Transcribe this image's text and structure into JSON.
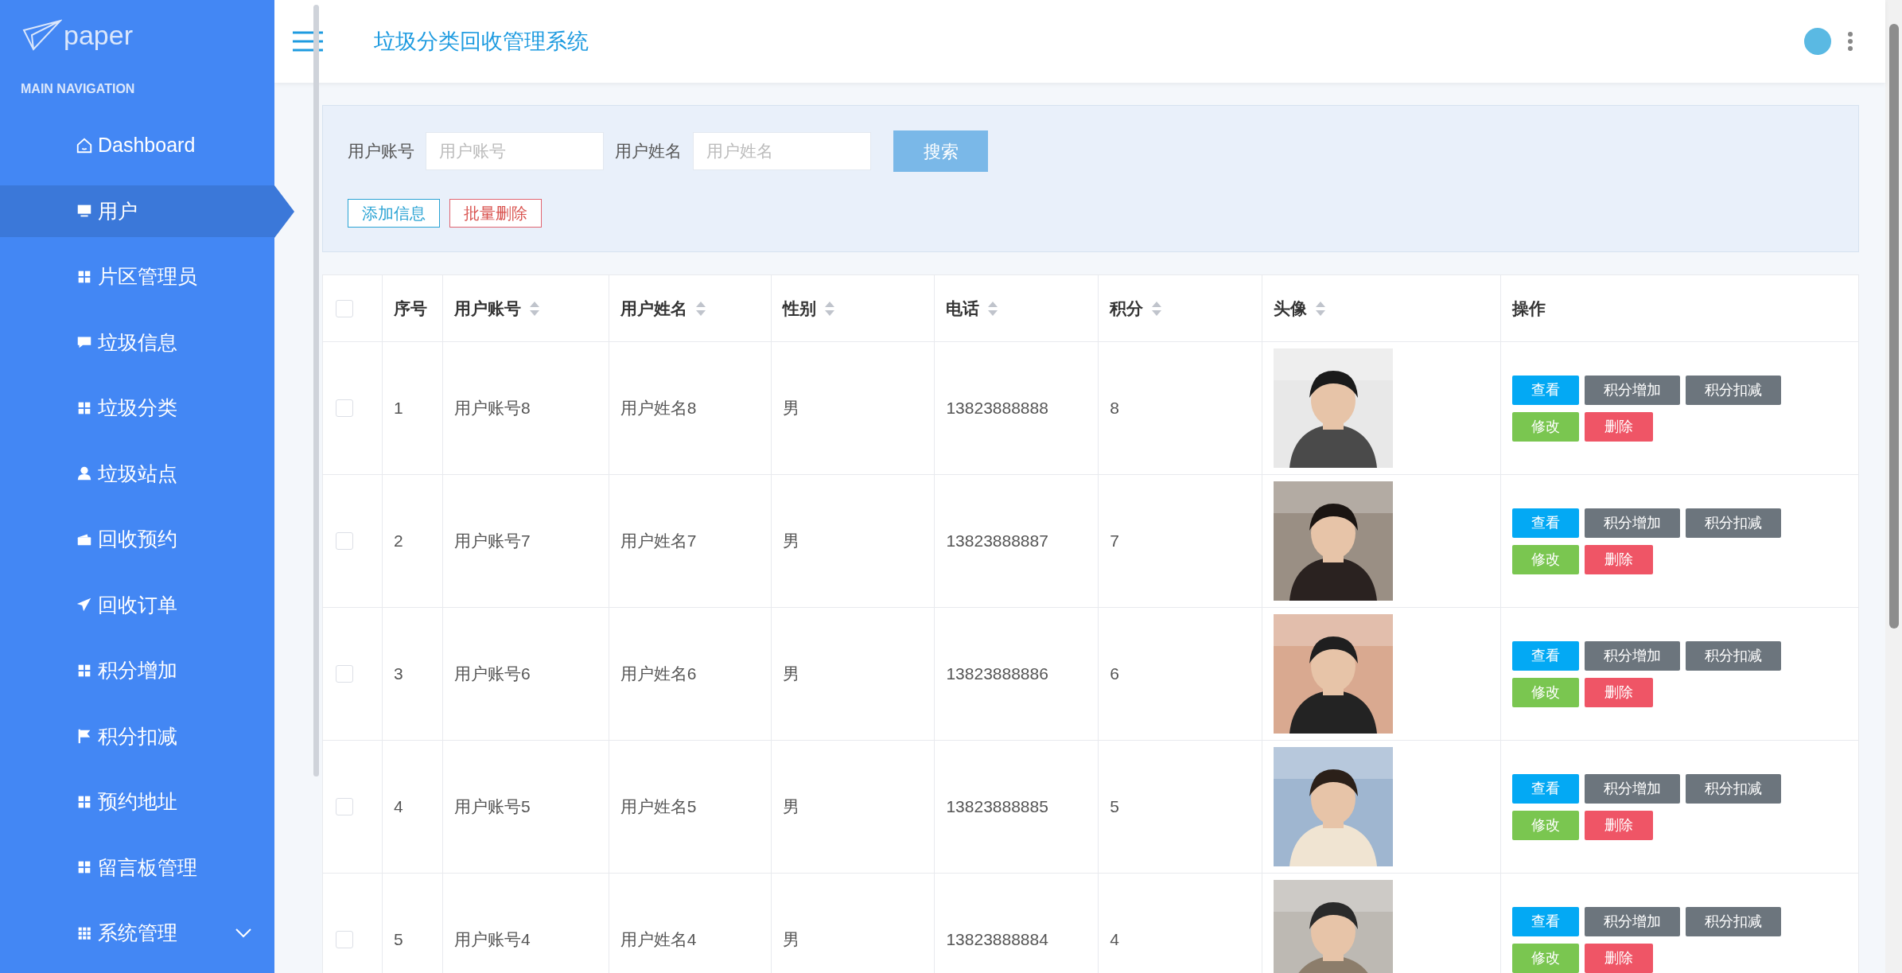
{
  "sidebar": {
    "logo": "paper",
    "section": "MAIN NAVIGATION",
    "items": [
      {
        "label": "Dashboard",
        "kind": "link",
        "selected": false
      },
      {
        "label": "用户",
        "kind": "link",
        "selected": true
      },
      {
        "label": "片区管理员",
        "kind": "link",
        "selected": false
      },
      {
        "label": "垃圾信息",
        "kind": "link",
        "selected": false
      },
      {
        "label": "垃圾分类",
        "kind": "link",
        "selected": false
      },
      {
        "label": "垃圾站点",
        "kind": "link",
        "selected": false
      },
      {
        "label": "回收预约",
        "kind": "link",
        "selected": false
      },
      {
        "label": "回收订单",
        "kind": "link",
        "selected": false
      },
      {
        "label": "积分增加",
        "kind": "link",
        "selected": false
      },
      {
        "label": "积分扣减",
        "kind": "link",
        "selected": false
      },
      {
        "label": "预约地址",
        "kind": "link",
        "selected": false
      },
      {
        "label": "留言板管理",
        "kind": "link",
        "selected": false
      },
      {
        "label": "系统管理",
        "kind": "menu",
        "selected": false,
        "expanded": false
      }
    ]
  },
  "header": {
    "title": "垃圾分类回收管理系统"
  },
  "search": {
    "fields": [
      {
        "label": "用户账号",
        "placeholder": "用户账号"
      },
      {
        "label": "用户姓名",
        "placeholder": "用户姓名"
      }
    ],
    "search_button": "搜索",
    "actions": [
      {
        "label": "添加信息",
        "kind": "add"
      },
      {
        "label": "批量删除",
        "kind": "delete"
      }
    ]
  },
  "table": {
    "select_all": {
      "checked": false
    },
    "columns": [
      {
        "label": "序号",
        "sortable": false
      },
      {
        "label": "用户账号",
        "sortable": true
      },
      {
        "label": "用户姓名",
        "sortable": true
      },
      {
        "label": "性别",
        "sortable": true
      },
      {
        "label": "电话",
        "sortable": true
      },
      {
        "label": "积分",
        "sortable": true
      },
      {
        "label": "头像",
        "sortable": true
      },
      {
        "label": "操作",
        "sortable": false
      }
    ],
    "rows": [
      {
        "checked": false,
        "cells": [
          "1",
          "用户账号8",
          "用户姓名8",
          "男",
          "13823888888",
          "8"
        ],
        "photo": {
          "kind": "picture"
        },
        "buttons": [
          {
            "label": "查看",
            "kind": "view"
          },
          {
            "label": "积分增加",
            "kind": "secondary"
          },
          {
            "label": "积分扣减",
            "kind": "secondary"
          },
          {
            "label": "修改",
            "kind": "edit"
          },
          {
            "label": "删除",
            "kind": "delete"
          }
        ]
      },
      {
        "checked": false,
        "cells": [
          "2",
          "用户账号7",
          "用户姓名7",
          "男",
          "13823888887",
          "7"
        ],
        "photo": {
          "kind": "picture"
        },
        "buttons": [
          {
            "label": "查看",
            "kind": "view"
          },
          {
            "label": "积分增加",
            "kind": "secondary"
          },
          {
            "label": "积分扣减",
            "kind": "secondary"
          },
          {
            "label": "修改",
            "kind": "edit"
          },
          {
            "label": "删除",
            "kind": "delete"
          }
        ]
      },
      {
        "checked": false,
        "cells": [
          "3",
          "用户账号6",
          "用户姓名6",
          "男",
          "13823888886",
          "6"
        ],
        "photo": {
          "kind": "picture"
        },
        "buttons": [
          {
            "label": "查看",
            "kind": "view"
          },
          {
            "label": "积分增加",
            "kind": "secondary"
          },
          {
            "label": "积分扣减",
            "kind": "secondary"
          },
          {
            "label": "修改",
            "kind": "edit"
          },
          {
            "label": "删除",
            "kind": "delete"
          }
        ]
      },
      {
        "checked": false,
        "cells": [
          "4",
          "用户账号5",
          "用户姓名5",
          "男",
          "13823888885",
          "5"
        ],
        "photo": {
          "kind": "picture"
        },
        "buttons": [
          {
            "label": "查看",
            "kind": "view"
          },
          {
            "label": "积分增加",
            "kind": "secondary"
          },
          {
            "label": "积分扣减",
            "kind": "secondary"
          },
          {
            "label": "修改",
            "kind": "edit"
          },
          {
            "label": "删除",
            "kind": "delete"
          }
        ]
      },
      {
        "checked": false,
        "cells": [
          "5",
          "用户账号4",
          "用户姓名4",
          "男",
          "13823888884",
          "4"
        ],
        "photo": {
          "kind": "picture"
        },
        "buttons": [
          {
            "label": "查看",
            "kind": "view"
          },
          {
            "label": "积分增加",
            "kind": "secondary"
          },
          {
            "label": "积分扣减",
            "kind": "secondary"
          },
          {
            "label": "修改",
            "kind": "edit"
          },
          {
            "label": "删除",
            "kind": "delete"
          }
        ]
      }
    ]
  }
}
